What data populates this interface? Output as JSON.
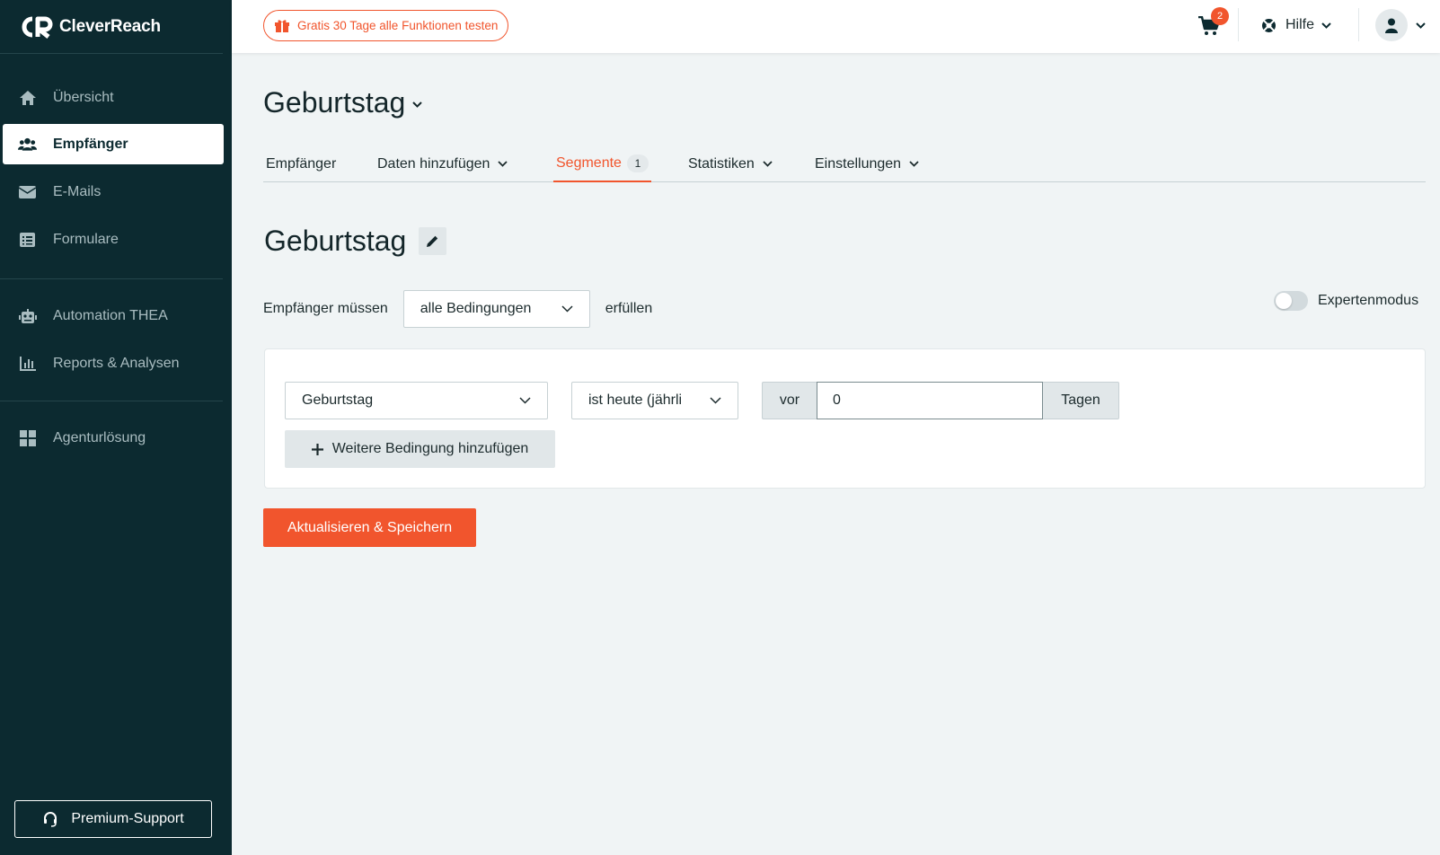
{
  "brand": {
    "name": "CleverReach",
    "accent": "#f1552d",
    "sidebar_bg": "#0c2a30"
  },
  "sidebar": {
    "items": [
      {
        "label": "Übersicht",
        "icon": "home-icon"
      },
      {
        "label": "Empfänger",
        "icon": "users-icon",
        "active": true
      },
      {
        "label": "E-Mails",
        "icon": "envelope-icon"
      },
      {
        "label": "Formulare",
        "icon": "form-icon"
      },
      {
        "label": "Automation THEA",
        "icon": "robot-icon"
      },
      {
        "label": "Reports & Analysen",
        "icon": "chart-icon"
      },
      {
        "label": "Agenturlösung",
        "icon": "grid-icon"
      }
    ],
    "support_label": "Premium-Support"
  },
  "topbar": {
    "trial_label": "Gratis 30 Tage alle Funktionen testen",
    "cart_count": "2",
    "help_label": "Hilfe"
  },
  "main": {
    "page_title": "Geburtstag",
    "tabs": [
      {
        "label": "Empfänger"
      },
      {
        "label": "Daten hinzufügen"
      },
      {
        "label": "Segmente",
        "count": "1",
        "active": true
      },
      {
        "label": "Statistiken"
      },
      {
        "label": "Einstellungen"
      }
    ],
    "segment_title": "Geburtstag",
    "condition_prefix": "Empfänger müssen",
    "condition_mode": "alle Bedingungen",
    "condition_suffix": "erfüllen",
    "expert_mode_label": "Expertenmodus",
    "expert_mode_on": false,
    "rule": {
      "field": "Geburtstag",
      "operator": "ist heute (jährli",
      "prefix": "vor",
      "value": "0",
      "suffix": "Tagen"
    },
    "add_condition_label": "Weitere Bedingung hinzufügen",
    "save_label": "Aktualisieren & Speichern"
  }
}
